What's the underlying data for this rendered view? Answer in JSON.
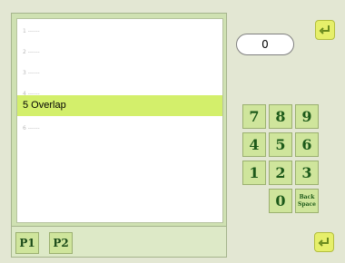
{
  "header": {
    "title": ""
  },
  "list": {
    "items": [
      {
        "label": "1 ------"
      },
      {
        "label": "2 ------"
      },
      {
        "label": "3 ------"
      },
      {
        "label": "4 ------"
      },
      {
        "label": "5 Overlap"
      },
      {
        "label": "6 ------"
      }
    ],
    "selected_index": 4
  },
  "pages": {
    "p1": "P1",
    "p2": "P2"
  },
  "input": {
    "value": "0"
  },
  "keypad": {
    "k7": "7",
    "k8": "8",
    "k9": "9",
    "k4": "4",
    "k5": "5",
    "k6": "6",
    "k1": "1",
    "k2": "2",
    "k3": "3",
    "k0": "0",
    "back": "Back Space"
  },
  "icons": {
    "top_corner": "return-arrow-icon",
    "bottom_corner": "confirm-arrow-icon"
  }
}
